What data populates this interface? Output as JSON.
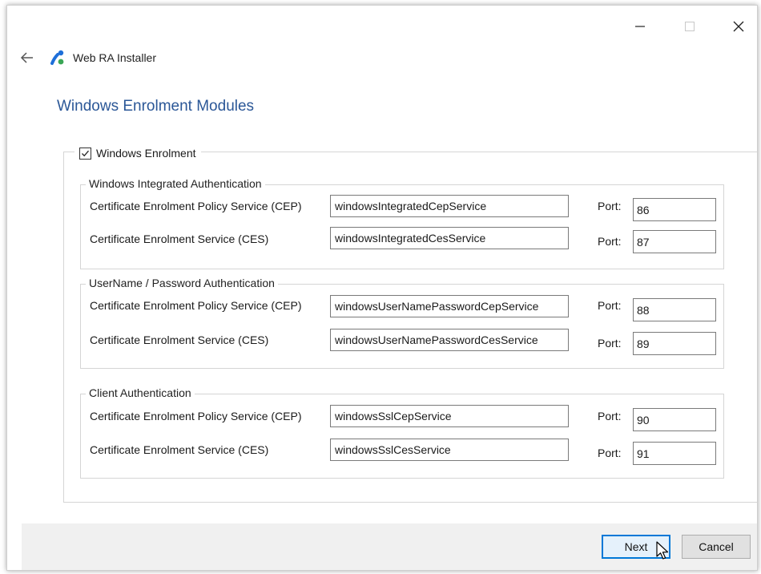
{
  "window": {
    "controls": {
      "minimize": "minimize",
      "maximize": "maximize",
      "close": "close"
    }
  },
  "app": {
    "title": "Web RA Installer"
  },
  "page": {
    "title": "Windows Enrolment Modules"
  },
  "windows_enrolment": {
    "label": "Windows Enrolment",
    "checked": true
  },
  "sections": [
    {
      "title": "Windows Integrated Authentication",
      "rows": [
        {
          "label": "Certificate Enrolment Policy Service (CEP)",
          "value": "windowsIntegratedCepService",
          "port_label": "Port:",
          "port": "86"
        },
        {
          "label": "Certificate Enrolment Service (CES)",
          "value": "windowsIntegratedCesService",
          "port_label": "Port:",
          "port": "87"
        }
      ]
    },
    {
      "title": "UserName / Password Authentication",
      "rows": [
        {
          "label": "Certificate Enrolment Policy Service (CEP)",
          "value": "windowsUserNamePasswordCepService",
          "port_label": "Port:",
          "port": "88"
        },
        {
          "label": "Certificate Enrolment Service (CES)",
          "value": "windowsUserNamePasswordCesService",
          "port_label": "Port:",
          "port": "89"
        }
      ]
    },
    {
      "title": "Client Authentication",
      "rows": [
        {
          "label": "Certificate Enrolment Policy Service (CEP)",
          "value": "windowsSslCepService",
          "port_label": "Port:",
          "port": "90"
        },
        {
          "label": "Certificate Enrolment Service (CES)",
          "value": "windowsSslCesService",
          "port_label": "Port:",
          "port": "91"
        }
      ]
    }
  ],
  "footer": {
    "next_label": "Next",
    "cancel_label": "Cancel"
  },
  "colors": {
    "title_blue": "#2b5797",
    "primary_border": "#0078d7",
    "logo_blue": "#1e6fd9",
    "logo_green": "#3aa655"
  }
}
